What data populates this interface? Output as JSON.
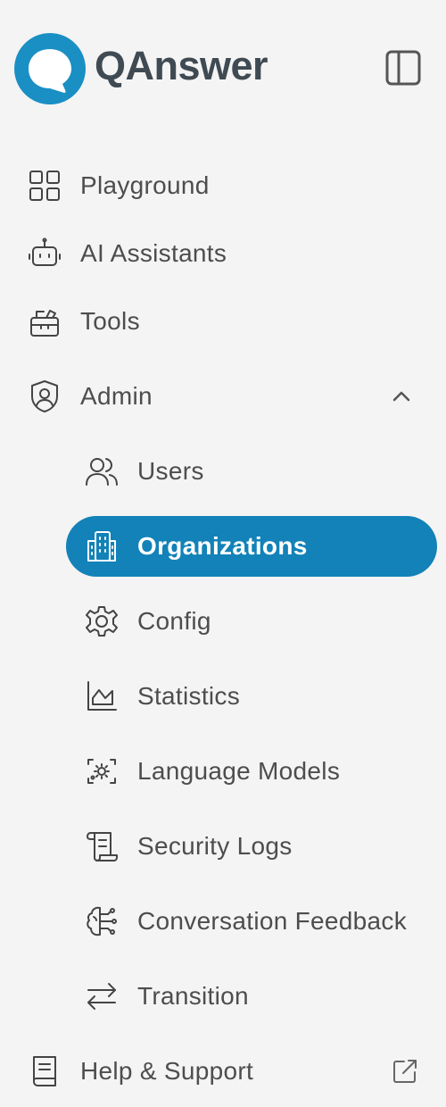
{
  "brand": {
    "name": "QAnswer",
    "accent_color": "#1a8fc4",
    "text_color": "#3f4a52"
  },
  "header": {
    "collapse_icon": "sidebar-toggle-icon"
  },
  "nav": {
    "playground": {
      "label": "Playground",
      "icon": "grid-icon"
    },
    "ai_assistants": {
      "label": "AI Assistants",
      "icon": "robot-icon"
    },
    "tools": {
      "label": "Tools",
      "icon": "toolbox-icon"
    },
    "admin": {
      "label": "Admin",
      "icon": "shield-user-icon",
      "expanded": true,
      "children": {
        "users": {
          "label": "Users",
          "icon": "users-icon"
        },
        "organizations": {
          "label": "Organizations",
          "icon": "building-icon",
          "active": true
        },
        "config": {
          "label": "Config",
          "icon": "gear-icon"
        },
        "statistics": {
          "label": "Statistics",
          "icon": "chart-icon"
        },
        "language_models": {
          "label": "Language Models",
          "icon": "model-icon"
        },
        "security_logs": {
          "label": "Security Logs",
          "icon": "scroll-icon"
        },
        "conversation_feedback": {
          "label": "Conversation Feedback",
          "icon": "brain-icon"
        },
        "transition": {
          "label": "Transition",
          "icon": "arrows-swap-icon"
        }
      }
    },
    "help_support": {
      "label": "Help & Support",
      "icon": "book-icon",
      "external": true
    }
  },
  "colors": {
    "active_background": "#1282b8",
    "active_text": "#ffffff",
    "sidebar_background": "#f4f4f4"
  }
}
